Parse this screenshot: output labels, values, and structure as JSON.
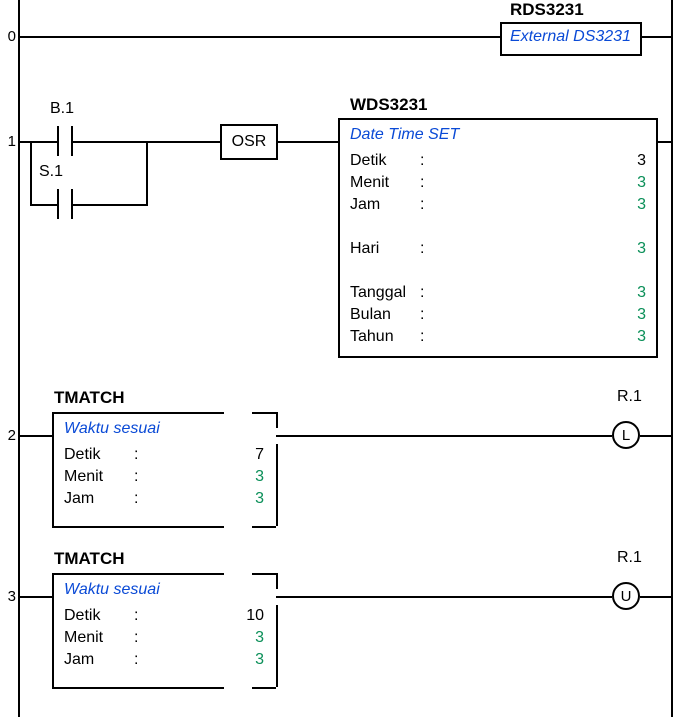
{
  "rungs": {
    "r0": "0",
    "r1": "1",
    "r2": "2",
    "r3": "3"
  },
  "contacts": {
    "b1": "B.1",
    "s1": "S.1"
  },
  "osr": "OSR",
  "rds": {
    "title": "RDS3231",
    "head": "External DS3231"
  },
  "wds": {
    "title": "WDS3231",
    "head": "Date Time SET",
    "rows": {
      "detik": {
        "lab": "Detik",
        "col": ":",
        "val": "3"
      },
      "menit": {
        "lab": "Menit",
        "col": ":",
        "val": "3"
      },
      "jam": {
        "lab": "Jam",
        "col": ":",
        "val": "3"
      },
      "hari": {
        "lab": "Hari",
        "col": ":",
        "val": "3"
      },
      "tanggal": {
        "lab": "Tanggal",
        "col": ":",
        "val": "3"
      },
      "bulan": {
        "lab": "Bulan",
        "col": ":",
        "val": "3"
      },
      "tahun": {
        "lab": "Tahun",
        "col": ":",
        "val": "3"
      }
    }
  },
  "tmatch2": {
    "title": "TMATCH",
    "head": "Waktu sesuai",
    "rows": {
      "detik": {
        "lab": "Detik",
        "col": ":",
        "val": "7"
      },
      "menit": {
        "lab": "Menit",
        "col": ":",
        "val": "3"
      },
      "jam": {
        "lab": "Jam",
        "col": ":",
        "val": "3"
      }
    }
  },
  "tmatch3": {
    "title": "TMATCH",
    "head": "Waktu sesuai",
    "rows": {
      "detik": {
        "lab": "Detik",
        "col": ":",
        "val": "10"
      },
      "menit": {
        "lab": "Menit",
        "col": ":",
        "val": "3"
      },
      "jam": {
        "lab": "Jam",
        "col": ":",
        "val": "3"
      }
    }
  },
  "coils": {
    "r2": {
      "label": "R.1",
      "type": "L"
    },
    "r3": {
      "label": "R.1",
      "type": "U"
    }
  }
}
